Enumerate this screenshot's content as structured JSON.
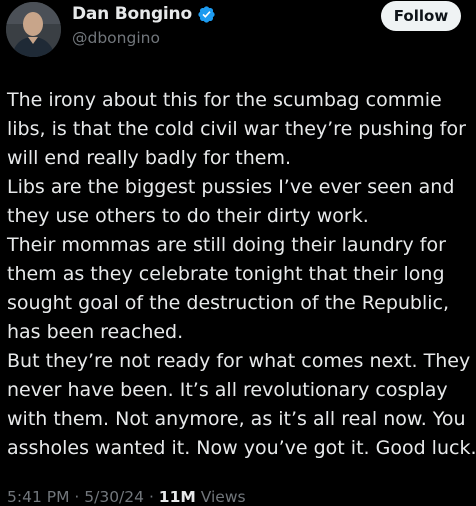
{
  "author": {
    "display_name": "Dan Bongino",
    "handle": "@dbongino",
    "verified_icon": "verified-badge-icon",
    "verified_color": "#1d9bf0"
  },
  "actions": {
    "follow_label": "Follow"
  },
  "tweet": {
    "lines": [
      "The irony about this for the scumbag commie",
      "libs, is that the cold civil war they’re pushing for",
      "will end really badly for them.",
      "Libs are the biggest pussies I’ve ever seen and",
      "they use others to do their dirty work.",
      "Their mommas are still doing their laundry for",
      "them as they celebrate tonight that their long",
      "sought goal of the destruction of the Republic,",
      "has been reached.",
      "But they’re not ready for what comes next. They",
      "never have been. It’s all revolutionary cosplay",
      "with them. Not anymore, as it’s all real now. You",
      "assholes wanted it. Now you’ve got it. Good luck."
    ]
  },
  "meta": {
    "time": "5:41 PM",
    "separator": " · ",
    "date": "5/30/24",
    "views_count": "11M",
    "views_label": " Views"
  },
  "colors": {
    "background": "#000000",
    "text_primary": "#e7e9ea",
    "text_secondary": "#71767b",
    "button_bg": "#eff3f4",
    "button_text": "#0f1419"
  }
}
